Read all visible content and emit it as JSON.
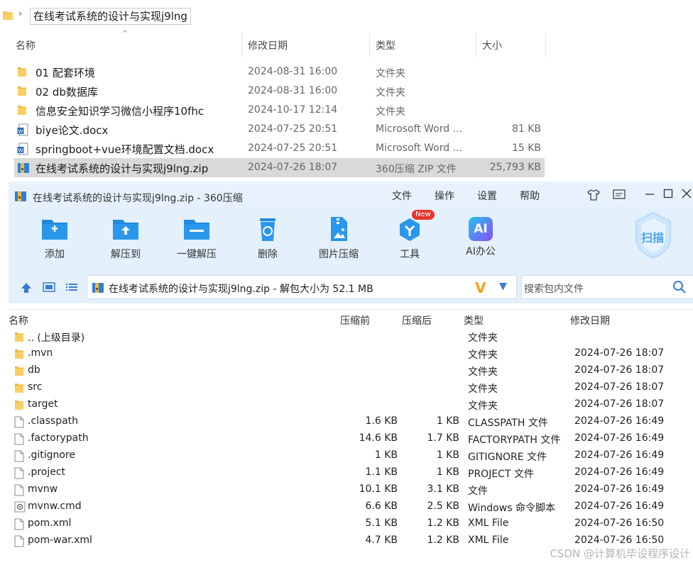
{
  "explorer": {
    "path": "在线考试系统的设计与实现j9lng",
    "columns": {
      "name": "名称",
      "date": "修改日期",
      "type": "类型",
      "size": "大小"
    },
    "rows": [
      {
        "icon": "folder",
        "name": "01 配套环境",
        "date": "2024-08-31 16:00",
        "type": "文件夹",
        "size": ""
      },
      {
        "icon": "folder",
        "name": "02 db数据库",
        "date": "2024-08-31 16:00",
        "type": "文件夹",
        "size": ""
      },
      {
        "icon": "folder",
        "name": "信息安全知识学习微信小程序10fhc",
        "date": "2024-10-17 12:14",
        "type": "文件夹",
        "size": ""
      },
      {
        "icon": "word",
        "name": "biye论文.docx",
        "date": "2024-07-25 20:51",
        "type": "Microsoft Word ...",
        "size": "81 KB"
      },
      {
        "icon": "word",
        "name": "springboot+vue环境配置文档.docx",
        "date": "2024-07-25 20:51",
        "type": "Microsoft Word ...",
        "size": "15 KB"
      },
      {
        "icon": "zip",
        "name": "在线考试系统的设计与实现j9lng.zip",
        "date": "2024-07-26 18:07",
        "type": "360压缩 ZIP 文件",
        "size": "25,793 KB",
        "selected": true
      }
    ]
  },
  "zip": {
    "title": "在线考试系统的设计与实现j9lng.zip - 360压缩",
    "menu": [
      "文件",
      "操作",
      "设置",
      "帮助"
    ],
    "toolbar": [
      {
        "icon": "add-icon",
        "label": "添加"
      },
      {
        "icon": "extract-to-icon",
        "label": "解压到"
      },
      {
        "icon": "one-click-extract-icon",
        "label": "一键解压"
      },
      {
        "icon": "delete-icon",
        "label": "删除"
      },
      {
        "icon": "image-compress-icon",
        "label": "图片压缩"
      },
      {
        "icon": "tools-icon",
        "label": "工具",
        "badge": "New"
      },
      {
        "icon": "ai-office-icon",
        "label": "AI办公"
      }
    ],
    "scan_label": "扫描",
    "ai_text": "AI",
    "path_text": "在线考试系统的设计与实现j9lng.zip - 解包大小为 52.1 MB",
    "search_placeholder": "搜索包内文件",
    "columns": {
      "name": "名称",
      "csize": "压缩前",
      "usize": "压缩后",
      "type": "类型",
      "date": "修改日期"
    },
    "rows": [
      {
        "icon": "folder",
        "name": ".. (上级目录)",
        "csize": "",
        "usize": "",
        "type": "文件夹",
        "date": ""
      },
      {
        "icon": "folder",
        "name": ".mvn",
        "csize": "",
        "usize": "",
        "type": "文件夹",
        "date": "2024-07-26 18:07"
      },
      {
        "icon": "folder",
        "name": "db",
        "csize": "",
        "usize": "",
        "type": "文件夹",
        "date": "2024-07-26 18:07"
      },
      {
        "icon": "folder",
        "name": "src",
        "csize": "",
        "usize": "",
        "type": "文件夹",
        "date": "2024-07-26 18:07"
      },
      {
        "icon": "folder",
        "name": "target",
        "csize": "",
        "usize": "",
        "type": "文件夹",
        "date": "2024-07-26 18:07"
      },
      {
        "icon": "file",
        "name": ".classpath",
        "csize": "1.6 KB",
        "usize": "1 KB",
        "type": "CLASSPATH 文件",
        "date": "2024-07-26 16:49"
      },
      {
        "icon": "file",
        "name": ".factorypath",
        "csize": "14.6 KB",
        "usize": "1.7 KB",
        "type": "FACTORYPATH 文件",
        "date": "2024-07-26 16:49"
      },
      {
        "icon": "file",
        "name": ".gitignore",
        "csize": "1 KB",
        "usize": "1 KB",
        "type": "GITIGNORE 文件",
        "date": "2024-07-26 16:49"
      },
      {
        "icon": "file",
        "name": ".project",
        "csize": "1.1 KB",
        "usize": "1 KB",
        "type": "PROJECT 文件",
        "date": "2024-07-26 16:49"
      },
      {
        "icon": "file",
        "name": "mvnw",
        "csize": "10.1 KB",
        "usize": "3.1 KB",
        "type": "文件",
        "date": "2024-07-26 16:49"
      },
      {
        "icon": "cmd",
        "name": "mvnw.cmd",
        "csize": "6.6 KB",
        "usize": "2.5 KB",
        "type": "Windows 命令脚本",
        "date": "2024-07-26 16:49"
      },
      {
        "icon": "file",
        "name": "pom.xml",
        "csize": "5.1 KB",
        "usize": "1.2 KB",
        "type": "XML File",
        "date": "2024-07-26 16:50"
      },
      {
        "icon": "file",
        "name": "pom-war.xml",
        "csize": "4.7 KB",
        "usize": "1.2 KB",
        "type": "XML File",
        "date": "2024-07-26 16:50"
      }
    ]
  },
  "watermark": "CSDN @计算机毕设程序设计",
  "colors": {
    "accent": "#1f8ae0",
    "folder": "#f5c04a",
    "toolbar_bg": "#e4f0fc",
    "selected_row": "#d9d9d9"
  }
}
